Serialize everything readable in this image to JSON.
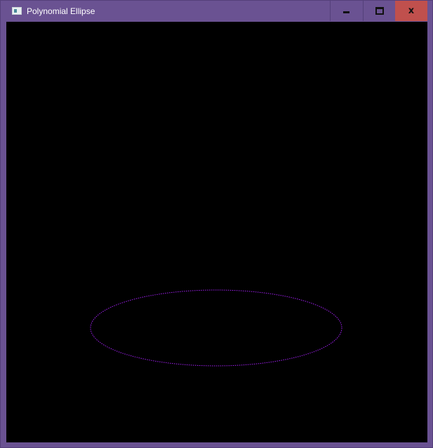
{
  "window": {
    "title": "Polynomial Ellipse",
    "app_icon": "window-app-icon",
    "controls": {
      "minimize_icon": "minimize-icon",
      "maximize_icon": "maximize-icon",
      "close_icon": "close-icon",
      "close_glyph": "x"
    },
    "colors": {
      "titlebar": "#6a5292",
      "close_button": "#c0504d",
      "canvas_background": "#000000",
      "ellipse_stroke": "#a020f0"
    }
  }
}
